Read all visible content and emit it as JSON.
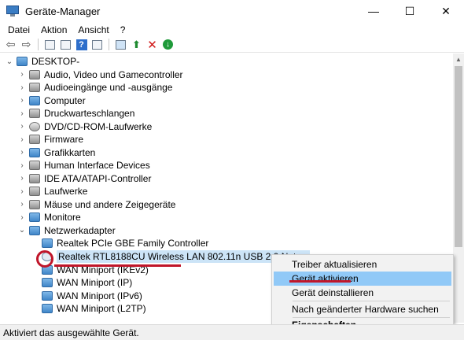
{
  "window": {
    "title": "Geräte-Manager",
    "minimize": "—",
    "maximize": "☐",
    "close": "✕"
  },
  "menu": [
    "Datei",
    "Aktion",
    "Ansicht",
    "?"
  ],
  "tree": {
    "root": "DESKTOP-",
    "categories": [
      "Audio, Video und Gamecontroller",
      "Audioeingänge und -ausgänge",
      "Computer",
      "Druckwarteschlangen",
      "DVD/CD-ROM-Laufwerke",
      "Firmware",
      "Grafikkarten",
      "Human Interface Devices",
      "IDE ATA/ATAPI-Controller",
      "Laufwerke",
      "Mäuse und andere Zeigegeräte",
      "Monitore",
      "Netzwerkadapter"
    ],
    "network_adapters": [
      "Realtek PCIe GBE Family Controller",
      "Realtek RTL8188CU Wireless LAN 802.11n USB 2.0 Netwo",
      "WAN Miniport (IKEv2)",
      "WAN Miniport (IP)",
      "WAN Miniport (IPv6)",
      "WAN Miniport (L2TP)"
    ]
  },
  "context_menu": {
    "items": [
      "Treiber aktualisieren",
      "Gerät aktivieren",
      "Gerät deinstallieren",
      "Nach geänderter Hardware suchen",
      "Eigenschaften"
    ]
  },
  "status": {
    "text": "Aktiviert das ausgewählte Gerät."
  },
  "colors": {
    "annotation": "#c0162a",
    "selection": "#cce4f7",
    "menu_hover": "#91c9f7"
  }
}
